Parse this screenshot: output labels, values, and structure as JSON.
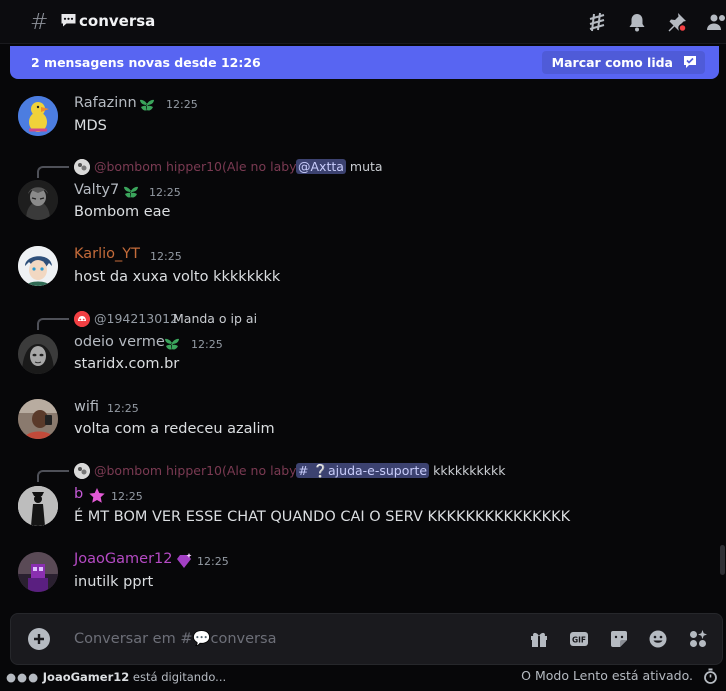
{
  "header": {
    "channel_name": "conversa"
  },
  "new_messages_bar": {
    "text": "2 mensagens novas desde 12:26",
    "mark_read_label": "Marcar como lida"
  },
  "messages": [
    {
      "username": "Rafazinn",
      "name_color": "#b5bac1",
      "time": "12:25",
      "text": "MDS"
    },
    {
      "reply_to": "@bombom hipper10(Ale no laby)",
      "reply_mention": "@Axtta",
      "reply_text": "muta",
      "username": "Valty7",
      "name_color": "#b5bac1",
      "time": "12:25",
      "text": "Bombom eae"
    },
    {
      "username": "Karlio_YT",
      "name_color": "#c46b3a",
      "time": "12:25",
      "text": "host da xuxa volto kkkkkkkk"
    },
    {
      "reply_to": "@194213012",
      "reply_text": "Manda o ip ai",
      "username": "odeio verme",
      "name_color": "#b5bac1",
      "time": "12:25",
      "text": "staridx.com.br"
    },
    {
      "username": "wifi",
      "name_color": "#b5bac1",
      "time": "12:25",
      "text": "volta com a redeceu azalim"
    },
    {
      "reply_to": "@bombom hipper10(Ale no laby)",
      "reply_channel": "# ❔ajuda-e-suporte",
      "reply_text": "kkkkkkkkkk",
      "username": "b",
      "name_color": "#c65ad8",
      "time": "12:25",
      "text": "É MT BOM VER ESSE CHAT QUANDO CAI O SERV KKKKKKKKKKKKKKK"
    },
    {
      "username": "JoaoGamer12",
      "name_color": "#b54ac4",
      "time": "12:25",
      "text": "inutilk pprt"
    }
  ],
  "composer": {
    "placeholder": "Conversar em #💬conversa"
  },
  "footer": {
    "typing_user": "JoaoGamer12",
    "typing_suffix": "está digitando...",
    "slowmode": "O Modo Lento está ativado."
  }
}
